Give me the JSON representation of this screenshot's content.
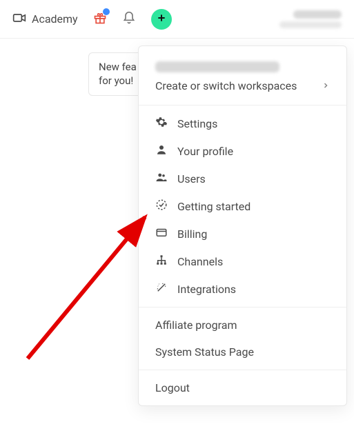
{
  "topbar": {
    "academy_label": "Academy"
  },
  "tooltip": {
    "line1": "New fea",
    "line2": "for you!"
  },
  "menu": {
    "switch_label": "Create or switch workspaces",
    "settings": "Settings",
    "profile": "Your profile",
    "users": "Users",
    "getting_started": "Getting started",
    "billing": "Billing",
    "channels": "Channels",
    "integrations": "Integrations",
    "affiliate": "Affiliate program",
    "status": "System Status Page",
    "logout": "Logout"
  }
}
